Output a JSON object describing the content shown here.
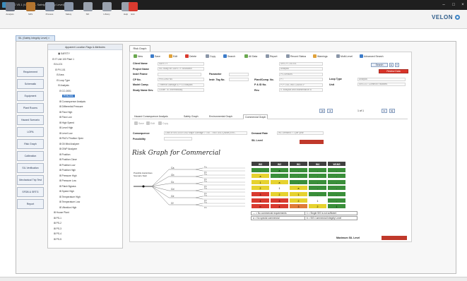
{
  "window": {
    "title": "SRS V5.1 (V4.0.0.0 - Safety integrity Level)"
  },
  "ribbon": {
    "buttons": [
      {
        "label": "Analysis",
        "icon": "analysis-icon",
        "color": "#6f7785"
      },
      {
        "label": "SRS",
        "icon": "gear-icon",
        "color": "#b4752f"
      },
      {
        "label": "Process",
        "icon": "process-icon",
        "color": "#8a96a8"
      },
      {
        "label": "Safety",
        "icon": "safety-icon",
        "color": "#8a96a8"
      },
      {
        "label": "SIF",
        "icon": "sif-icon",
        "color": "#9aa2ad"
      },
      {
        "label": "Library",
        "icon": "library-icon",
        "color": "#9aa2ad"
      },
      {
        "label": "Help",
        "icon": "help-icon",
        "color": "#9aa2ad"
      },
      {
        "label": "Exit",
        "icon": "exit-icon",
        "color": "#d93a2f"
      }
    ],
    "logo": "VELON"
  },
  "document_tab": {
    "label": "SIL (Safety Integrity Level) ×"
  },
  "nav": {
    "items": [
      "Requirement",
      "Schematic",
      "Equipment",
      "Plant Rooms",
      "Hazard Scenario",
      "LOPA",
      "Risk Graph",
      "Calibration",
      "SIL Verification",
      "Mechanical Trip Test",
      "SFDB & SRTG",
      "Report"
    ]
  },
  "tree": {
    "header": "Apparent Location  Flags & Attributes",
    "nodes": [
      "▣ SAFETY",
      "⊟ IT Unit 100 Plant 1",
      "⊟ A-101",
      "⊟ PV-101",
      "⊟ Area",
      "⊟ Loop Type",
      "⊟ Analysis",
      "⊟ CC-0001",
      "PHN-001",
      "⊞ Consequence Analysis",
      "⊞ Differential Pressure",
      "⊞ Flow High",
      "⊞ Flow Low",
      "⊞ High Speed",
      "⊞ Level High",
      "⊞ Level Low",
      "⊞ PACV Position Open",
      "⊞ Oil Mist Analyzer",
      "⊞ OWP Analyzer",
      "⊞ Position",
      "⊞ Position Close",
      "⊞ Position Low",
      "⊞ Position High",
      "⊞ Pressure High",
      "⊞ Pressure Low",
      "⊞ Flash Bypass",
      "⊞ Speed High",
      "⊞ Temperature High",
      "⊞ Temperature Low",
      "⊞ Vibration High",
      "⊞ House Plant",
      "⊞ PS-1",
      "⊞ PS-2",
      "⊞ PS-3",
      "⊞ PS-4",
      "⊞ PS-5"
    ],
    "selected_index": 8
  },
  "main": {
    "tab": "Risk Graph",
    "toolbar": [
      {
        "label": "New",
        "icon": "new-icon",
        "color": "#6aa84f"
      },
      {
        "label": "Save",
        "icon": "save-icon",
        "color": "#3d7cc9"
      },
      {
        "label": "Edit",
        "icon": "edit-icon",
        "color": "#e0a23b"
      },
      {
        "label": "Delete",
        "icon": "delete-icon",
        "color": "#d93a2f"
      },
      {
        "label": "Copy",
        "icon": "copy-icon",
        "color": "#8a96a8"
      },
      {
        "label": "Search",
        "icon": "search-icon",
        "color": "#3d7cc9"
      },
      {
        "label": "All Data",
        "icon": "all-data-icon",
        "color": "#6aa84f"
      },
      {
        "label": "Report",
        "icon": "report-icon",
        "color": "#8a96a8"
      },
      {
        "label": "Record Status",
        "icon": "record-status-icon",
        "color": "#8a96a8"
      },
      {
        "label": "Warnings",
        "icon": "warning-icon",
        "color": "#e0a23b"
      },
      {
        "label": "Multi-Level",
        "icon": "multi-level-icon",
        "color": "#8a96a8"
      },
      {
        "label": "Advanced Search",
        "icon": "advanced-search-icon",
        "color": "#3d7cc9"
      }
    ],
    "form": {
      "left": [
        {
          "label": "Client Name",
          "value": "SAFETY"
        },
        {
          "label": "Project Name",
          "value": "SIL Study for SAFETY Shutdown"
        },
        {
          "label": "Instrl Frame",
          "value": ""
        },
        {
          "label": "CP No.",
          "value": "PKV-UNITNS"
        },
        {
          "label": "Model Comp.",
          "value": "Thermal Damage & PTD Analysis"
        },
        {
          "label": "Study Name Dev.",
          "value": "Cooler Tk. Intermediary"
        }
      ],
      "middle": [
        {
          "label": "Parameter",
          "value": ""
        },
        {
          "label": "Instr. Tag No.",
          "value": ""
        }
      ],
      "right": [
        {
          "label": "",
          "value": "SRS-PT-04-001"
        },
        {
          "label": "",
          "value": "Analysis"
        },
        {
          "label": "",
          "value": "PV-Sensors"
        },
        {
          "label": "Plant/Comp. No.",
          "value": "PT"
        },
        {
          "label": "P & ID No.",
          "value": "P-PT-SIL-INS-CAUSE-F"
        },
        {
          "label": "Rev.",
          "value": "IT Analysis and Maintenance B"
        }
      ],
      "right2": [
        {
          "label": "Loop Type",
          "value": "Analysis"
        },
        {
          "label": "Unit",
          "value": "SRS-01 / Common Facilities"
        }
      ],
      "search_label": "Search",
      "review_label": "Review Data",
      "pager": "1 of 1"
    },
    "subtabs": [
      "Hazard Consequence Analysis",
      "Safety Graph",
      "Environmental Graph",
      "Commercial Graph"
    ],
    "active_subtab": 3,
    "sub_toolbar": [
      "Save",
      "Edit",
      "Copy"
    ],
    "consequence": {
      "label": "Consequence",
      "value": "Loss of 500-1000 USD Major Damage > 750 - 7500 USD (Asset) Env...",
      "possibility_label": "Possibility",
      "possibility_value": "",
      "demand_rate_label": "Demand Rate",
      "demand_rate_value": "W1 Demand > 1 per year",
      "sil_label": "SIL Level",
      "sil_color": "#c0392b"
    },
    "risk_graph": {
      "title": "Risk Graph for Commercial",
      "start_label": "Possible Hazardous Scenario Start",
      "branches": [
        "Ca",
        "Cb",
        "Cc",
        "Cd",
        "Ce",
        "Cf"
      ],
      "subbranches": [
        "Fa",
        "Fb"
      ],
      "header": [
        "W3",
        "W2",
        "W1",
        "W4",
        "W1NS"
      ],
      "rows": [
        [
          {
            "t": "-",
            "c": "#3a8f3a"
          },
          {
            "t": "a",
            "c": "#3a8f3a"
          },
          {
            "t": "-",
            "c": "#3a8f3a"
          },
          {
            "t": "-",
            "c": "#3a8f3a"
          },
          {
            "t": "-",
            "c": "#3a8f3a"
          }
        ],
        [
          {
            "t": "a",
            "c": "#e6d22f"
          },
          {
            "t": "-",
            "c": "#3a8f3a"
          },
          {
            "t": "-",
            "c": "#3a8f3a"
          },
          {
            "t": "-",
            "c": "#3a8f3a"
          },
          {
            "t": "-",
            "c": "#3a8f3a"
          }
        ],
        [
          {
            "t": "1",
            "c": "#e6d22f"
          },
          {
            "t": "a",
            "c": "#e6d22f"
          },
          {
            "t": "-",
            "c": "#3a8f3a"
          },
          {
            "t": "-",
            "c": "#3a8f3a"
          },
          {
            "t": "-",
            "c": "#3a8f3a"
          }
        ],
        [
          {
            "t": "2",
            "c": "#e6d22f"
          },
          {
            "t": "1",
            "c": "#ffffff"
          },
          {
            "t": "a",
            "c": "#e6d22f"
          },
          {
            "t": "-",
            "c": "#3a8f3a"
          },
          {
            "t": "-",
            "c": "#3a8f3a"
          }
        ],
        [
          {
            "t": "3",
            "c": "#d93a2f"
          },
          {
            "t": "2",
            "c": "#e6d22f"
          },
          {
            "t": "1",
            "c": "#e6d22f"
          },
          {
            "t": "-",
            "c": "#3a8f3a"
          },
          {
            "t": "-",
            "c": "#3a8f3a"
          }
        ],
        [
          {
            "t": "4",
            "c": "#d93a2f"
          },
          {
            "t": "3",
            "c": "#d93a2f"
          },
          {
            "t": "2",
            "c": "#e6d22f"
          },
          {
            "t": "1",
            "c": "#ffffff"
          },
          {
            "t": "-",
            "c": "#3a8f3a"
          }
        ],
        [
          {
            "t": "b",
            "c": "#d93a2f"
          },
          {
            "t": "4",
            "c": "#d93a2f"
          },
          {
            "t": "3",
            "c": "#e07b39"
          },
          {
            "t": "2",
            "c": "#e6d22f"
          },
          {
            "t": "1",
            "c": "#3a8f3a"
          }
        ]
      ],
      "legend": [
        "--- = No commercial requirements",
        "a = No special commercial",
        "1 = Single SIS is not sufficient",
        "b = SIS Commercial Integrity Level"
      ],
      "maximum_sil_label": "Maximum SIL Level",
      "maximum_sil_color": "#c0392b"
    }
  }
}
